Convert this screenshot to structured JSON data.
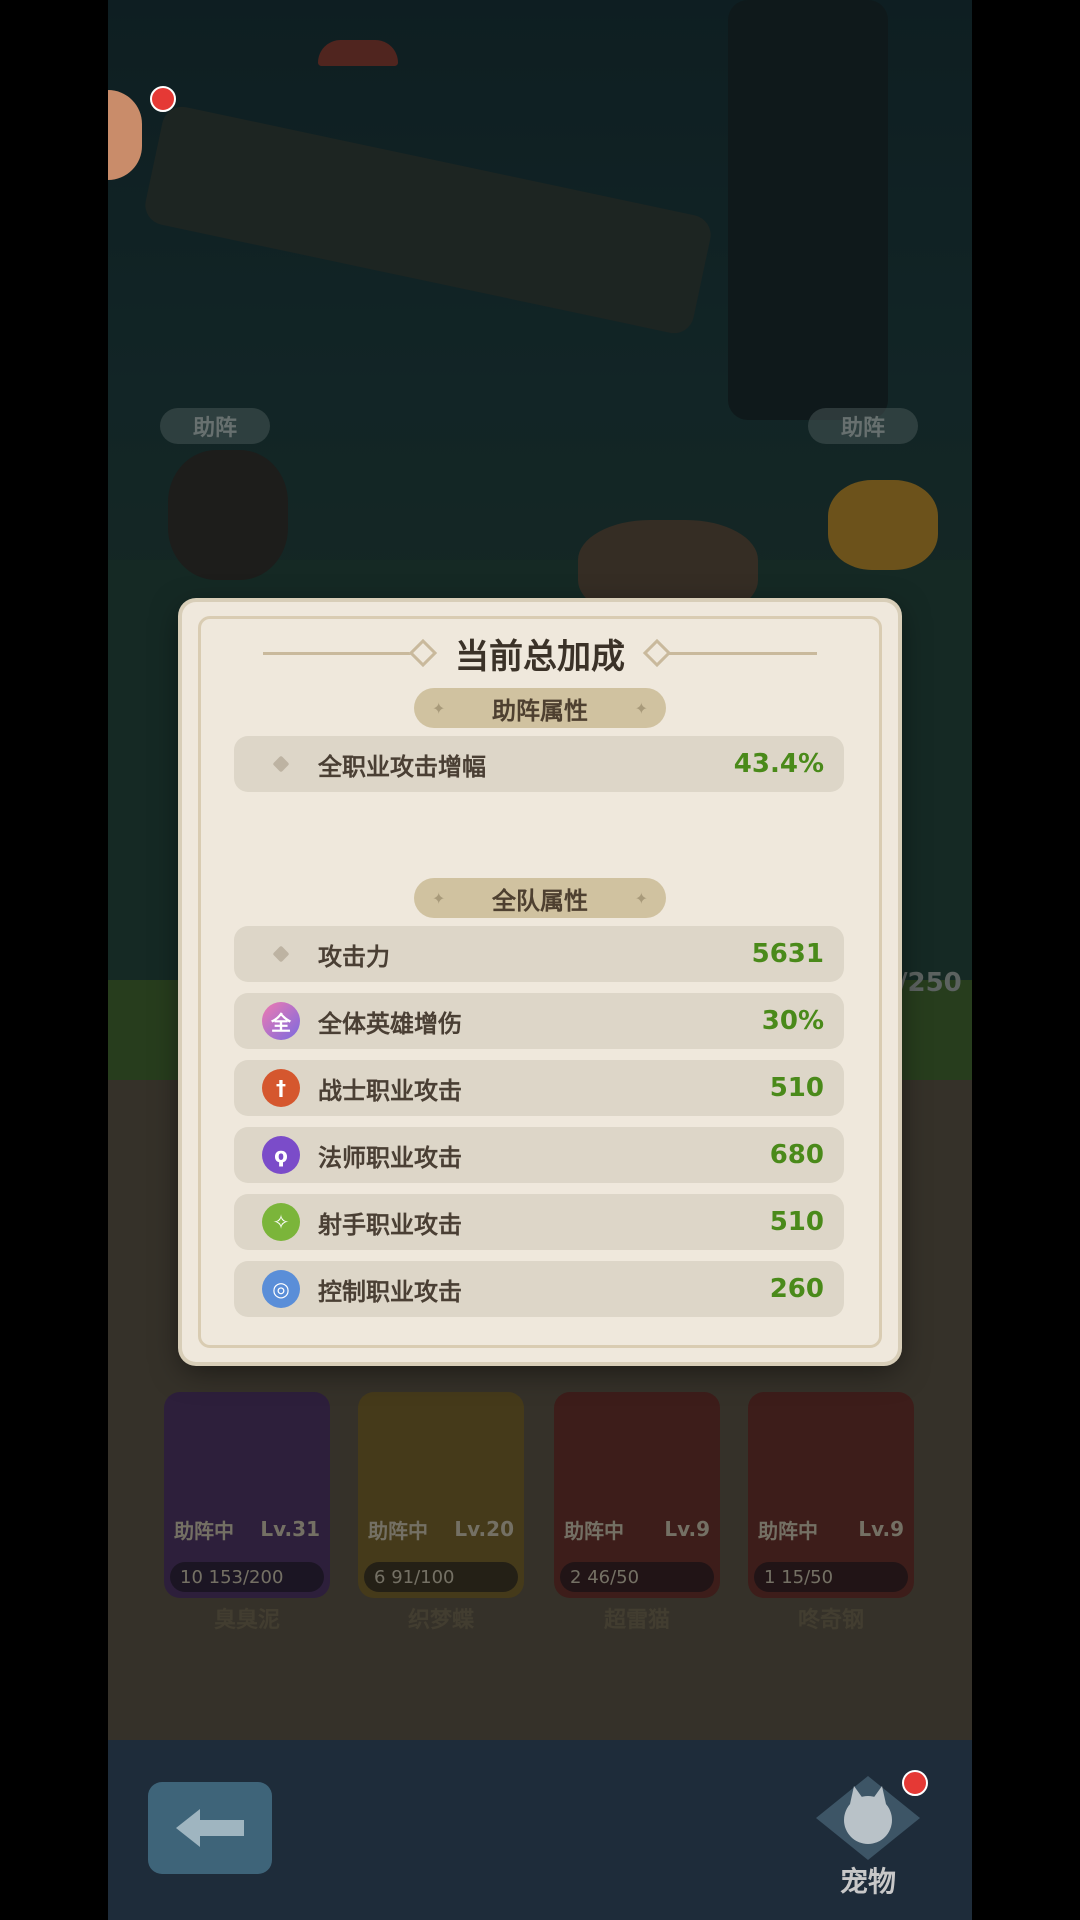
{
  "background": {
    "assist_tag_left": "助阵",
    "assist_tag_right": "助阵",
    "hero_count_fragment": "/250"
  },
  "pets": [
    {
      "name": "臭臭泥",
      "status": "助阵中",
      "level": "Lv.31",
      "stars": "10",
      "progress": "153/200",
      "color": "#6a3f8a"
    },
    {
      "name": "织梦蝶",
      "status": "助阵中",
      "level": "Lv.20",
      "stars": "6",
      "progress": "91/100",
      "color": "#c9a63a"
    },
    {
      "name": "超雷猫",
      "status": "助阵中",
      "level": "Lv.9",
      "stars": "2",
      "progress": "46/50",
      "color": "#a9423d"
    },
    {
      "name": "咚奇钢",
      "status": "助阵中",
      "level": "Lv.9",
      "stars": "1",
      "progress": "15/50",
      "color": "#a9423d"
    }
  ],
  "nav": {
    "pet_label": "宠物",
    "back_icon": "arrow-left-icon",
    "pet_icon": "cat-icon"
  },
  "modal": {
    "title": "当前总加成",
    "assist_section": "助阵属性",
    "assist_rows": [
      {
        "label": "全职业攻击增幅",
        "value": "43.4%",
        "icon": "diamond-dot-icon"
      }
    ],
    "team_section": "全队属性",
    "team_rows": [
      {
        "label": "攻击力",
        "value": "5631",
        "icon": "diamond-dot-icon",
        "icon_color": "#bdb3a2",
        "glyph": ""
      },
      {
        "label": "全体英雄增伤",
        "value": "30%",
        "icon": "all-heroes-icon",
        "icon_color": "#9b6ad6",
        "glyph": "全"
      },
      {
        "label": "战士职业攻击",
        "value": "510",
        "icon": "sword-icon",
        "icon_color": "#d5572e",
        "glyph": "†"
      },
      {
        "label": "法师职业攻击",
        "value": "680",
        "icon": "staff-icon",
        "icon_color": "#7b4cc9",
        "glyph": "ϙ"
      },
      {
        "label": "射手职业攻击",
        "value": "510",
        "icon": "bow-icon",
        "icon_color": "#7bb53a",
        "glyph": "✧"
      },
      {
        "label": "控制职业攻击",
        "value": "260",
        "icon": "swirl-icon",
        "icon_color": "#5a8ed8",
        "glyph": "◎"
      }
    ],
    "value_color": "#4a8a1a"
  }
}
